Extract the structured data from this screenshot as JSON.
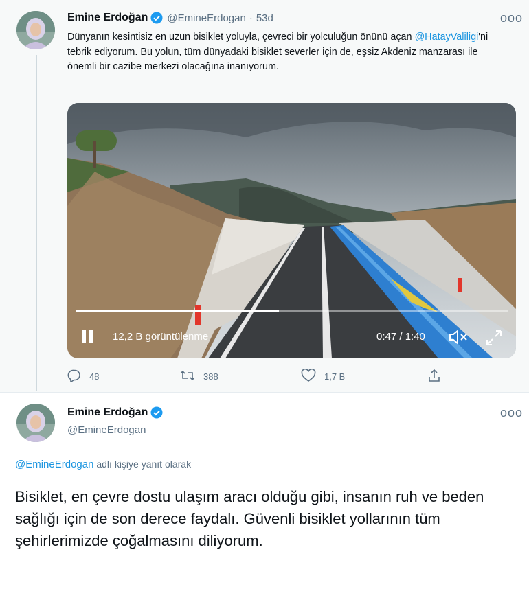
{
  "tweet1": {
    "author_name": "Emine Erdoğan",
    "handle": "@EmineErdogan",
    "separator": "·",
    "time": "53d",
    "more": "ooo",
    "text_part1": "Dünyanın kesintisiz en uzun bisiklet yoluyla, çevreci bir yolculuğun önünü açan ",
    "mention": "@HatayValiligi",
    "text_part2": "'ni tebrik ediyorum. Bu yolun, tüm dünyadaki bisiklet severler için de, eşsiz Akdeniz manzarası ile önemli bir cazibe merkezi olacağına inanıyorum.",
    "video": {
      "views": "12,2 B görüntülenme",
      "timecode": "0:47 / 1:40",
      "progress_fraction": 0.47
    },
    "actions": {
      "replies": "48",
      "retweets": "388",
      "likes": "1,7 B"
    }
  },
  "tweet2": {
    "author_name": "Emine Erdoğan",
    "handle": "@EmineErdogan",
    "more": "ooo",
    "reply_mention": "@EmineErdogan",
    "reply_suffix": " adlı kişiye yanıt olarak",
    "text": "Bisiklet, en çevre dostu ulaşım aracı olduğu gibi, insanın ruh ve beden sağlığı için de son derece faydalı. Güvenli bisiklet yollarının tüm şehirlerimizde çoğalmasını diliyorum."
  },
  "colors": {
    "accent": "#1b95e0",
    "muted": "#5b7083",
    "verified": "#1d9bf0"
  }
}
